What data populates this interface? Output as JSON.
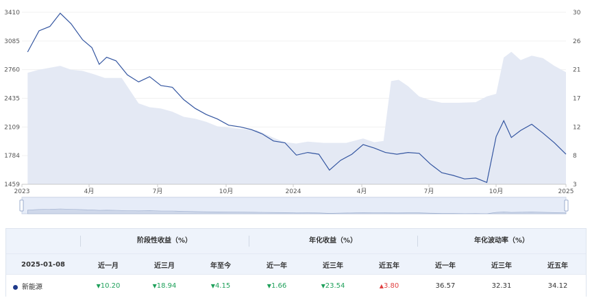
{
  "chart_data": {
    "type": "line",
    "left_axis": {
      "ticks": [
        "3410",
        "3085",
        "2760",
        "2435",
        "2109",
        "1784",
        "1459"
      ],
      "range": [
        1459,
        3410
      ]
    },
    "right_axis": {
      "ticks": [
        "30",
        "26",
        "21",
        "17",
        "12",
        "8",
        "3"
      ],
      "range": [
        3,
        30
      ]
    },
    "x_axis": {
      "ticks": [
        "2023",
        "4月",
        "7月",
        "10月",
        "2024",
        "4月",
        "7月",
        "10月",
        "2025"
      ]
    },
    "series": [
      {
        "role": "line",
        "color": "#3355a0",
        "x": [
          "2023-01",
          "2023-01",
          "2023-02",
          "2023-02",
          "2023-03",
          "2023-03",
          "2023-04",
          "2023-04",
          "2023-04",
          "2023-05",
          "2023-05",
          "2023-06",
          "2023-06",
          "2023-07",
          "2023-07",
          "2023-08",
          "2023-08",
          "2023-09",
          "2023-09",
          "2023-10",
          "2023-10",
          "2023-11",
          "2023-11",
          "2023-12",
          "2023-12",
          "2024-01",
          "2024-01",
          "2024-02",
          "2024-02",
          "2024-03",
          "2024-03",
          "2024-04",
          "2024-04",
          "2024-05",
          "2024-05",
          "2024-06",
          "2024-06",
          "2024-07",
          "2024-07",
          "2024-08",
          "2024-08",
          "2024-09",
          "2024-09",
          "2024-10",
          "2024-10",
          "2024-10",
          "2024-11",
          "2024-11",
          "2024-12",
          "2024-12",
          "2025-01"
        ],
        "y": [
          2960,
          3200,
          3250,
          3400,
          3280,
          3100,
          3010,
          2820,
          2900,
          2860,
          2700,
          2620,
          2680,
          2580,
          2560,
          2420,
          2320,
          2250,
          2200,
          2130,
          2110,
          2080,
          2030,
          1950,
          1930,
          1790,
          1820,
          1800,
          1620,
          1730,
          1800,
          1910,
          1870,
          1820,
          1800,
          1820,
          1810,
          1690,
          1590,
          1560,
          1520,
          1530,
          1480,
          2000,
          2180,
          1990,
          2070,
          2140,
          2040,
          1930,
          1800
        ]
      },
      {
        "role": "area",
        "color": "#e4e9f4",
        "x": [
          "2023-01",
          "2023-01",
          "2023-02",
          "2023-02",
          "2023-03",
          "2023-03",
          "2023-04",
          "2023-04",
          "2023-05",
          "2023-06",
          "2023-06",
          "2023-07",
          "2023-07",
          "2023-08",
          "2023-08",
          "2023-09",
          "2023-09",
          "2023-10",
          "2023-11",
          "2023-12",
          "2023-12",
          "2024-01",
          "2024-01",
          "2024-02",
          "2024-03",
          "2024-04",
          "2024-04",
          "2024-05",
          "2024-05",
          "2024-05",
          "2024-06",
          "2024-06",
          "2024-07",
          "2024-07",
          "2024-08",
          "2024-09",
          "2024-09",
          "2024-10",
          "2024-10",
          "2024-10",
          "2024-11",
          "2024-11",
          "2024-12",
          "2024-12",
          "2025-01"
        ],
        "y": [
          20.5,
          21,
          21.3,
          21.6,
          21,
          20.8,
          20.3,
          19.7,
          19.7,
          15.7,
          15.1,
          14.9,
          14.4,
          13.6,
          13.3,
          12.8,
          12.1,
          11.8,
          11.5,
          10.3,
          9.6,
          9.4,
          9.7,
          9.5,
          9.5,
          10.2,
          9.6,
          9.8,
          19.2,
          19.4,
          18.4,
          16.8,
          16.2,
          15.8,
          15.8,
          15.9,
          16.8,
          17.2,
          22.9,
          23.8,
          22.5,
          23.2,
          22.8,
          21.6,
          20.6
        ]
      }
    ]
  },
  "table": {
    "groups": [
      "阶段性收益（%）",
      "年化收益（%）",
      "年化波动率（%）"
    ],
    "date": "2025-01-08",
    "columns": [
      "近一月",
      "近三月",
      "年至今",
      "近一年",
      "近三年",
      "近五年",
      "近一年",
      "近三年",
      "近五年"
    ],
    "row": {
      "name": "新能源",
      "values": [
        {
          "text": "10.20",
          "dir": "down"
        },
        {
          "text": "18.94",
          "dir": "down"
        },
        {
          "text": "4.15",
          "dir": "down"
        },
        {
          "text": "1.66",
          "dir": "down"
        },
        {
          "text": "23.54",
          "dir": "down"
        },
        {
          "text": "3.80",
          "dir": "up"
        },
        {
          "text": "36.57",
          "dir": ""
        },
        {
          "text": "32.31",
          "dir": ""
        },
        {
          "text": "34.12",
          "dir": ""
        }
      ]
    }
  }
}
